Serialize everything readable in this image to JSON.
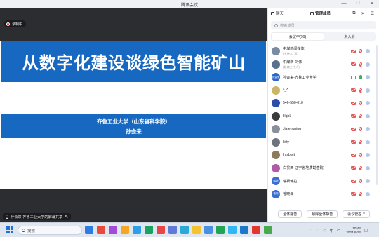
{
  "window": {
    "title": "腾讯会议",
    "controls": [
      "—",
      "□",
      "✕"
    ]
  },
  "stage": {
    "recording_label": "录制中",
    "slide": {
      "title": "从数字化建设谈绿色智能矿山",
      "subtitle": "齐鲁工业大学（山东省科学院）",
      "author": "孙会来"
    },
    "sharer_label": "孙会来-齐鲁工业大学的屏幕共享"
  },
  "panel": {
    "tabs": {
      "chat": "聊天",
      "members": "管理成员"
    },
    "search_placeholder": "搜索成员",
    "segments": {
      "in_meeting": "会议中(99)",
      "not_joined": "未入会"
    },
    "participants": [
      {
        "name": "中煤新闻媒体",
        "role": "(主持人, 我)",
        "avatar_text": "",
        "avatar_color": "#7b8aa3",
        "mic": "off",
        "cam": "off"
      },
      {
        "name": "中煤新-刘伟",
        "role": "(联席主持人)",
        "avatar_text": "",
        "avatar_color": "#5b6f8f",
        "mic": "off",
        "cam": "off"
      },
      {
        "name": "孙会来-齐鲁工业大学",
        "role": "",
        "avatar_text": "孙会来",
        "avatar_color": "#2e67c9",
        "mic": "on",
        "cam": "screen"
      },
      {
        "name": "^_^",
        "role": "",
        "avatar_text": "",
        "avatar_color": "#c9b66a",
        "mic": "off",
        "cam": "off"
      },
      {
        "name": "546-550-010",
        "role": "",
        "avatar_text": "",
        "avatar_color": "#2b4ea8",
        "mic": "off",
        "cam": "off"
      },
      {
        "name": "HqhL",
        "role": "",
        "avatar_text": "",
        "avatar_color": "#3b3b3b",
        "mic": "off",
        "cam": "off"
      },
      {
        "name": "Jiafengping",
        "role": "",
        "avatar_text": "",
        "avatar_color": "#8a8f9a",
        "mic": "off",
        "cam": "off"
      },
      {
        "name": "kitty",
        "role": "",
        "avatar_text": "",
        "avatar_color": "#6d7480",
        "mic": "off",
        "cam": "off"
      },
      {
        "name": "lmsbixjt",
        "role": "",
        "avatar_text": "",
        "avatar_color": "#8d7b5e",
        "mic": "off",
        "cam": "off"
      },
      {
        "name": "白贯西-辽宁省地质勘查院",
        "role": "",
        "avatar_text": "",
        "avatar_color": "#b05aa8",
        "mic": "off",
        "cam": "off"
      },
      {
        "name": "瑞祯伸拉",
        "role": "",
        "avatar_text": "瑞祯",
        "avatar_color": "#3a6fd2",
        "mic": "off",
        "cam": "off"
      },
      {
        "name": "曾晓年",
        "role": "",
        "avatar_text": "曾晓",
        "avatar_color": "#3a6fd2",
        "mic": "off",
        "cam": "off"
      }
    ],
    "footer": {
      "mute_all": "全体静音",
      "unmute_all": "解除全体静音",
      "meeting_mgmt": "会议管控"
    }
  },
  "taskbar": {
    "search_label": "搜索",
    "time": "10:43",
    "date": "2024/6/23",
    "ime": "中",
    "app_colors": [
      "#2d7be5",
      "#e84a3c",
      "#a14bd8",
      "#f5a623",
      "#2ba0e8",
      "#1aa260",
      "#e64646",
      "#5f7bd6",
      "#2aa8d8",
      "#f4c430",
      "#4a90e2",
      "#23a455",
      "#30b6f0",
      "#1c78c8",
      "#e2372f",
      "#48a84a"
    ]
  },
  "colors": {
    "slide_blue": "#1668c0",
    "accent": "#1c72d6",
    "muted_red": "#e25959"
  }
}
